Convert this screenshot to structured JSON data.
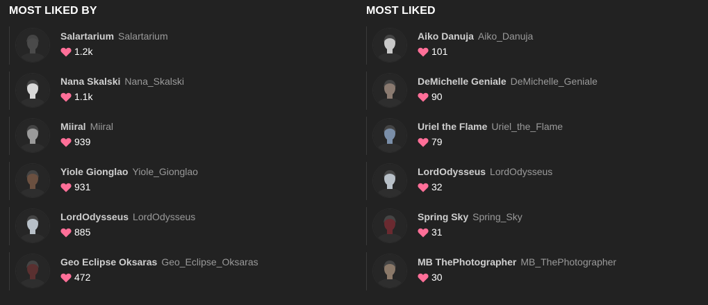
{
  "colors": {
    "background": "#222222",
    "heart": "#ff6f98",
    "title": "#ffffff",
    "display_name": "#cfcfcf",
    "username": "#9a9a9a"
  },
  "most_liked_by": {
    "title": "MOST LIKED BY",
    "items": [
      {
        "display_name": "Salartarium",
        "username": "Salartarium",
        "likes": "1.2k",
        "avatar_icon": "avatar-portrait-icon",
        "tone": "#4a4a4a"
      },
      {
        "display_name": "Nana Skalski",
        "username": "Nana_Skalski",
        "likes": "1.1k",
        "avatar_icon": "avatar-portrait-icon",
        "tone": "#d8d8d8"
      },
      {
        "display_name": "Miiral",
        "username": "Miiral",
        "likes": "939",
        "avatar_icon": "avatar-portrait-icon",
        "tone": "#9a9a9a"
      },
      {
        "display_name": "Yiole Gionglao",
        "username": "Yiole_Gionglao",
        "likes": "931",
        "avatar_icon": "avatar-portrait-icon",
        "tone": "#6b5040"
      },
      {
        "display_name": "LordOdysseus",
        "username": "LordOdysseus",
        "likes": "885",
        "avatar_icon": "avatar-portrait-icon",
        "tone": "#b8c0c8"
      },
      {
        "display_name": "Geo Eclipse Oksaras",
        "username": "Geo_Eclipse_Oksaras",
        "likes": "472",
        "avatar_icon": "avatar-portrait-icon",
        "tone": "#5a3030"
      }
    ]
  },
  "most_liked": {
    "title": "MOST LIKED",
    "items": [
      {
        "display_name": "Aiko Danuja",
        "username": "Aiko_Danuja",
        "likes": "101",
        "avatar_icon": "avatar-portrait-icon",
        "tone": "#c8c8c8"
      },
      {
        "display_name": "DeMichelle Geniale",
        "username": "DeMichelle_Geniale",
        "likes": "90",
        "avatar_icon": "avatar-portrait-icon",
        "tone": "#8a7a70"
      },
      {
        "display_name": "Uriel the Flame",
        "username": "Uriel_the_Flame",
        "likes": "79",
        "avatar_icon": "avatar-portrait-icon",
        "tone": "#7a8ea8"
      },
      {
        "display_name": "LordOdysseus",
        "username": "LordOdysseus",
        "likes": "32",
        "avatar_icon": "avatar-portrait-icon",
        "tone": "#b8c0c8"
      },
      {
        "display_name": "Spring Sky",
        "username": "Spring_Sky",
        "likes": "31",
        "avatar_icon": "avatar-portrait-icon",
        "tone": "#6a2a30"
      },
      {
        "display_name": "MB ThePhotographer",
        "username": "MB_ThePhotographer",
        "likes": "30",
        "avatar_icon": "avatar-portrait-icon",
        "tone": "#8a7868"
      }
    ]
  }
}
